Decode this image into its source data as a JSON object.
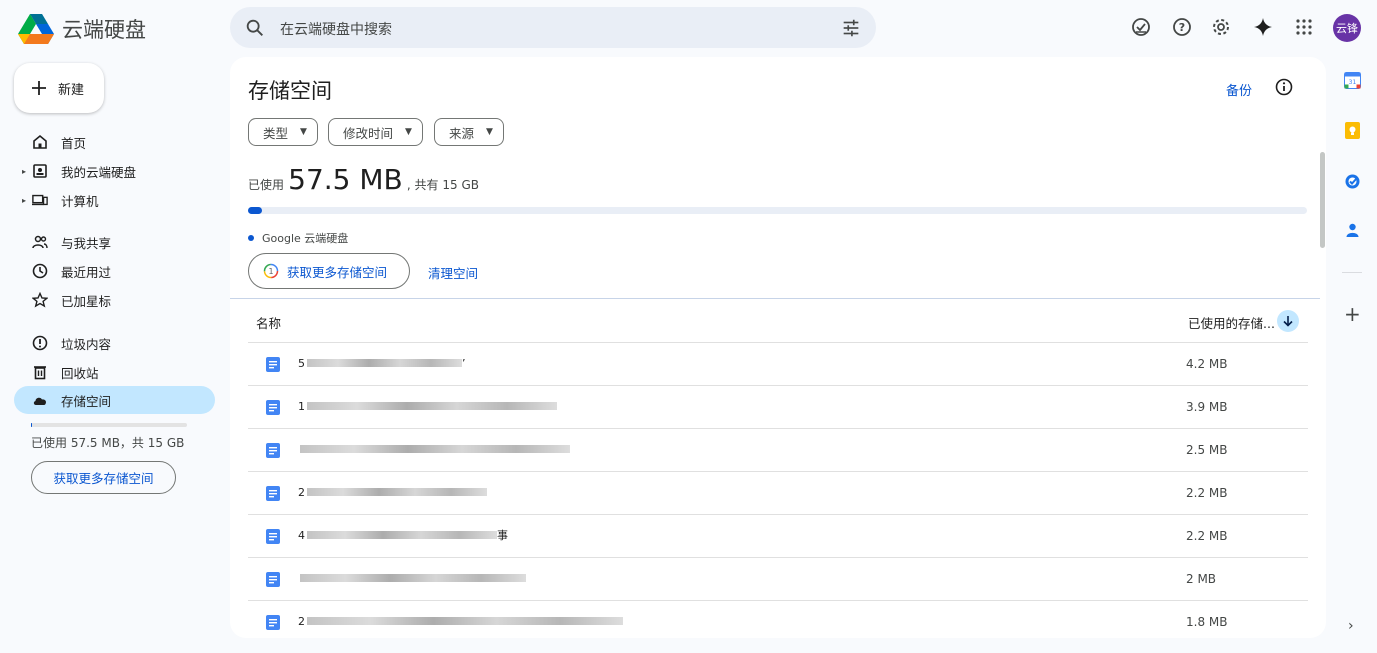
{
  "header": {
    "app_title": "云端硬盘",
    "search_placeholder": "在云端硬盘中搜索",
    "avatar_text": "云锋"
  },
  "nav": {
    "new_label": "新建",
    "items": [
      {
        "label": "首页",
        "icon": "home-icon"
      },
      {
        "label": "我的云端硬盘",
        "icon": "my-drive-icon"
      },
      {
        "label": "计算机",
        "icon": "computer-icon"
      },
      {
        "label": "与我共享",
        "icon": "shared-icon"
      },
      {
        "label": "最近用过",
        "icon": "clock-icon"
      },
      {
        "label": "已加星标",
        "icon": "star-icon"
      },
      {
        "label": "垃圾内容",
        "icon": "spam-icon"
      },
      {
        "label": "回收站",
        "icon": "trash-icon"
      },
      {
        "label": "存储空间",
        "icon": "cloud-icon"
      }
    ],
    "quota_text": "已使用 57.5 MB，共 15 GB",
    "quota_fraction": 0.004,
    "get_more_label": "获取更多存储空间"
  },
  "main": {
    "title": "存储空间",
    "backup_label": "备份",
    "chips": [
      "类型",
      "修改时间",
      "来源"
    ],
    "used_prefix": "已使用",
    "used_amount": "57.5 MB",
    "used_suffix": ", 共有 15 GB",
    "usage_fraction": 0.004,
    "legend_label": "Google 云端硬盘",
    "get_more_label": "获取更多存储空间",
    "clean_label": "清理空间",
    "col_name": "名称",
    "col_used": "已使用的存储...",
    "rows": [
      {
        "first_char": "5",
        "last_char": "’",
        "size": "4.2 MB"
      },
      {
        "first_char": "1",
        "last_char": "",
        "size": "3.9 MB"
      },
      {
        "first_char": "",
        "last_char": "",
        "size": "2.5 MB"
      },
      {
        "first_char": "2",
        "last_char": "",
        "size": "2.2 MB"
      },
      {
        "first_char": "4",
        "last_char": "事",
        "size": "2.2 MB"
      },
      {
        "first_char": "",
        "last_char": "",
        "size": "2 MB"
      },
      {
        "first_char": "2",
        "last_char": "",
        "size": "1.8 MB"
      }
    ]
  },
  "colors": {
    "accent": "#0b57d0",
    "active_nav": "#c2e7ff",
    "search_bg": "#e9eef6",
    "avatar_bg": "#6833a6"
  }
}
